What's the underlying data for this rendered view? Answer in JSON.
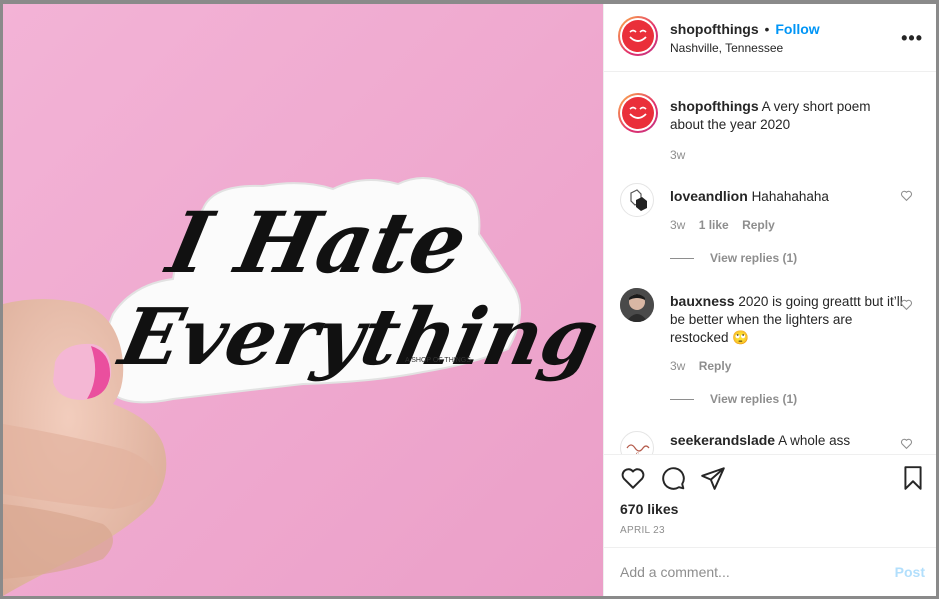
{
  "post": {
    "username": "shopofthings",
    "separator": "•",
    "follow_label": "Follow",
    "location": "Nashville, Tennessee",
    "more_label": "•••",
    "brand_color": "#ea2f3a"
  },
  "photo": {
    "sticker_line1": "I Hate",
    "sticker_line2": "Everything",
    "sticker_credit": "A SHOP OF THINGS",
    "background_color": "#f0a9cf"
  },
  "caption": {
    "username": "shopofthings",
    "text": "A very short poem about the year 2020",
    "time": "3w"
  },
  "comments": [
    {
      "username": "loveandlion",
      "text": "Hahahahaha",
      "time": "3w",
      "likes": "1 like",
      "reply_label": "Reply",
      "view_replies": "View replies (1)"
    },
    {
      "username": "bauxness",
      "text": "2020 is going greattt but it’ll be better when the lighters are restocked 🙄",
      "time": "3w",
      "reply_label": "Reply",
      "view_replies": "View replies (1)"
    },
    {
      "username": "seekerandslade",
      "text": "A whole ass"
    }
  ],
  "actions": {
    "like_icon": "heart-icon",
    "comment_icon": "comment-icon",
    "share_icon": "share-icon",
    "save_icon": "bookmark-icon",
    "likes_count": "670 likes",
    "date": "APRIL 23"
  },
  "composer": {
    "placeholder": "Add a comment...",
    "post_label": "Post"
  }
}
